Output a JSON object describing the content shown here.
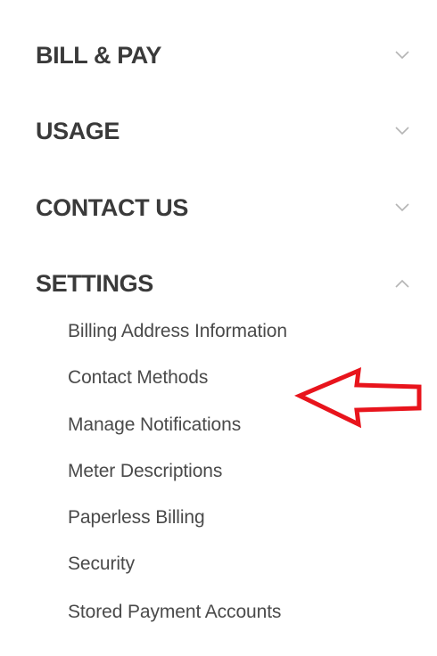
{
  "nav": {
    "sections": [
      {
        "label": "BILL & PAY",
        "expanded": false
      },
      {
        "label": "USAGE",
        "expanded": false
      },
      {
        "label": "CONTACT US",
        "expanded": false
      },
      {
        "label": "SETTINGS",
        "expanded": true
      }
    ],
    "settings_items": [
      "Billing Address Information",
      "Contact Methods",
      "Manage Notifications",
      "Meter Descriptions",
      "Paperless Billing",
      "Security",
      "Stored Payment Accounts"
    ]
  },
  "icons": {
    "collapsed": "chevron-down-icon",
    "expanded": "chevron-up-icon",
    "annotation": "red-arrow-outline"
  },
  "colors": {
    "heading": "#3a3a3a",
    "item": "#4a4a4a",
    "chevron": "#b5b5b5",
    "annotation": "#e8141c"
  }
}
